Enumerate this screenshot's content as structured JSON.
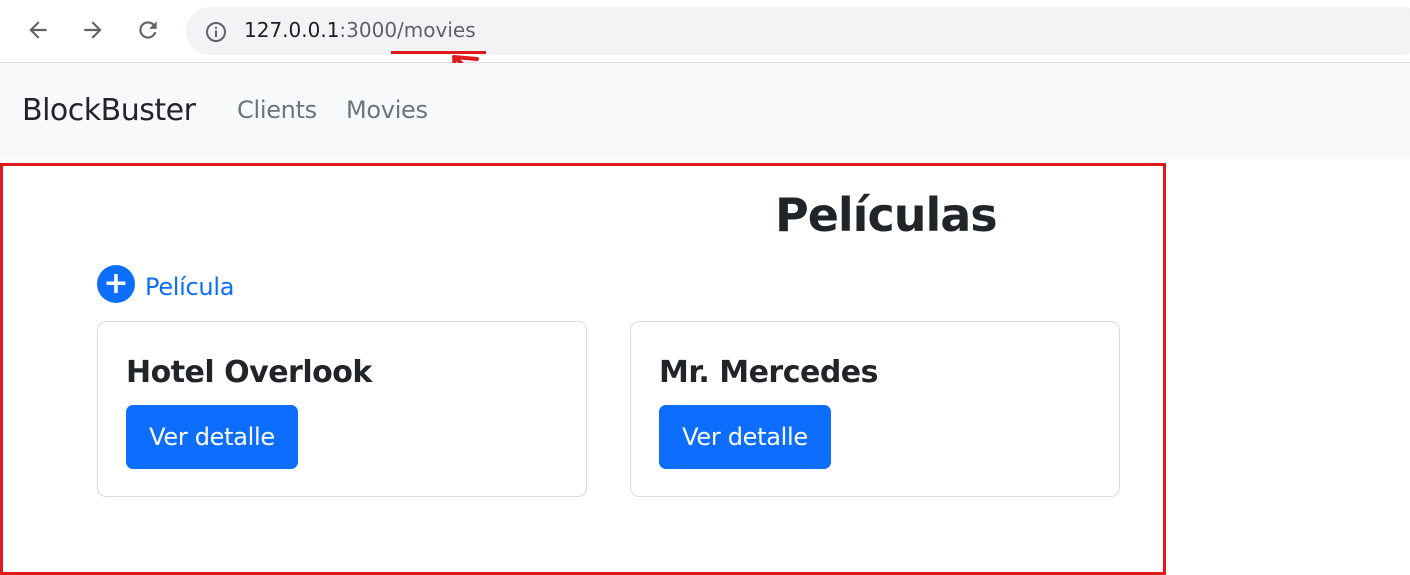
{
  "browser": {
    "url_host": "127.0.0.1",
    "url_rest": ":3000/movies",
    "annotation_color": "#e0191b"
  },
  "navbar": {
    "brand": "BlockBuster",
    "links": [
      {
        "label": "Clients"
      },
      {
        "label": "Movies"
      }
    ]
  },
  "main": {
    "title": "Películas",
    "add_label": "Película",
    "add_icon": "plus-circle-icon",
    "cards": [
      {
        "title": "Hotel Overlook",
        "button_label": "Ver detalle"
      },
      {
        "title": "Mr. Mercedes",
        "button_label": "Ver detalle"
      }
    ]
  },
  "colors": {
    "primary": "#0d6efd",
    "navbar_bg": "#f8f9fa",
    "highlight": "#e0191b"
  }
}
